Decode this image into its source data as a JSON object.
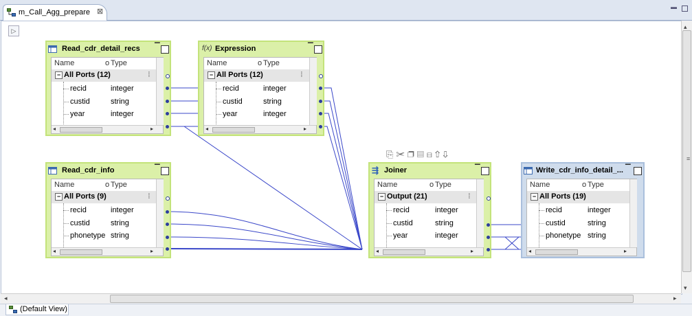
{
  "editor": {
    "tab_title": "m_Call_Agg_prepare",
    "tab_close": "⊠"
  },
  "footer": {
    "view_label": "(Default View)"
  },
  "colors": {
    "source_node": "#dbf0a8",
    "target_node": "#cfdcec",
    "link": "#3a47c9"
  },
  "transformations": [
    {
      "id": "read_cdr_detail_recs",
      "title": "Read_cdr_detail_recs",
      "icon": "source-table-icon",
      "col_name": "Name",
      "col_type": "Type",
      "group": "All Ports (12)",
      "ports": [
        {
          "name": "recid",
          "type": "integer"
        },
        {
          "name": "custid",
          "type": "string"
        },
        {
          "name": "year",
          "type": "integer"
        }
      ]
    },
    {
      "id": "expression",
      "title": "Expression",
      "icon": "function-icon",
      "col_name": "Name",
      "col_type": "Type",
      "group": "All Ports (12)",
      "ports": [
        {
          "name": "recid",
          "type": "integer"
        },
        {
          "name": "custid",
          "type": "string"
        },
        {
          "name": "year",
          "type": "integer"
        }
      ]
    },
    {
      "id": "read_cdr_info",
      "title": "Read_cdr_info",
      "icon": "source-table-icon",
      "col_name": "Name",
      "col_type": "Type",
      "group": "All Ports (9)",
      "ports": [
        {
          "name": "recid",
          "type": "integer"
        },
        {
          "name": "custid",
          "type": "string"
        },
        {
          "name": "phonetype",
          "type": "string"
        }
      ]
    },
    {
      "id": "joiner",
      "title": "Joiner",
      "icon": "joiner-icon",
      "col_name": "Name",
      "col_type": "Type",
      "group": "Output (21)",
      "ports": [
        {
          "name": "recid",
          "type": "integer"
        },
        {
          "name": "custid",
          "type": "string"
        },
        {
          "name": "year",
          "type": "integer"
        }
      ]
    },
    {
      "id": "write_cdr_info_detail",
      "title": "Write_cdr_info_detail_...",
      "icon": "target-table-icon",
      "col_name": "Name",
      "col_type": "Type",
      "group": "All Ports (19)",
      "ports": [
        {
          "name": "recid",
          "type": "integer"
        },
        {
          "name": "custid",
          "type": "string"
        },
        {
          "name": "phonetype",
          "type": "string"
        }
      ]
    }
  ],
  "joiner_toolbar": [
    "add-port-icon",
    "cut-icon",
    "copy-icon",
    "paste-icon",
    "delete-icon",
    "move-up-icon",
    "move-down-icon"
  ]
}
